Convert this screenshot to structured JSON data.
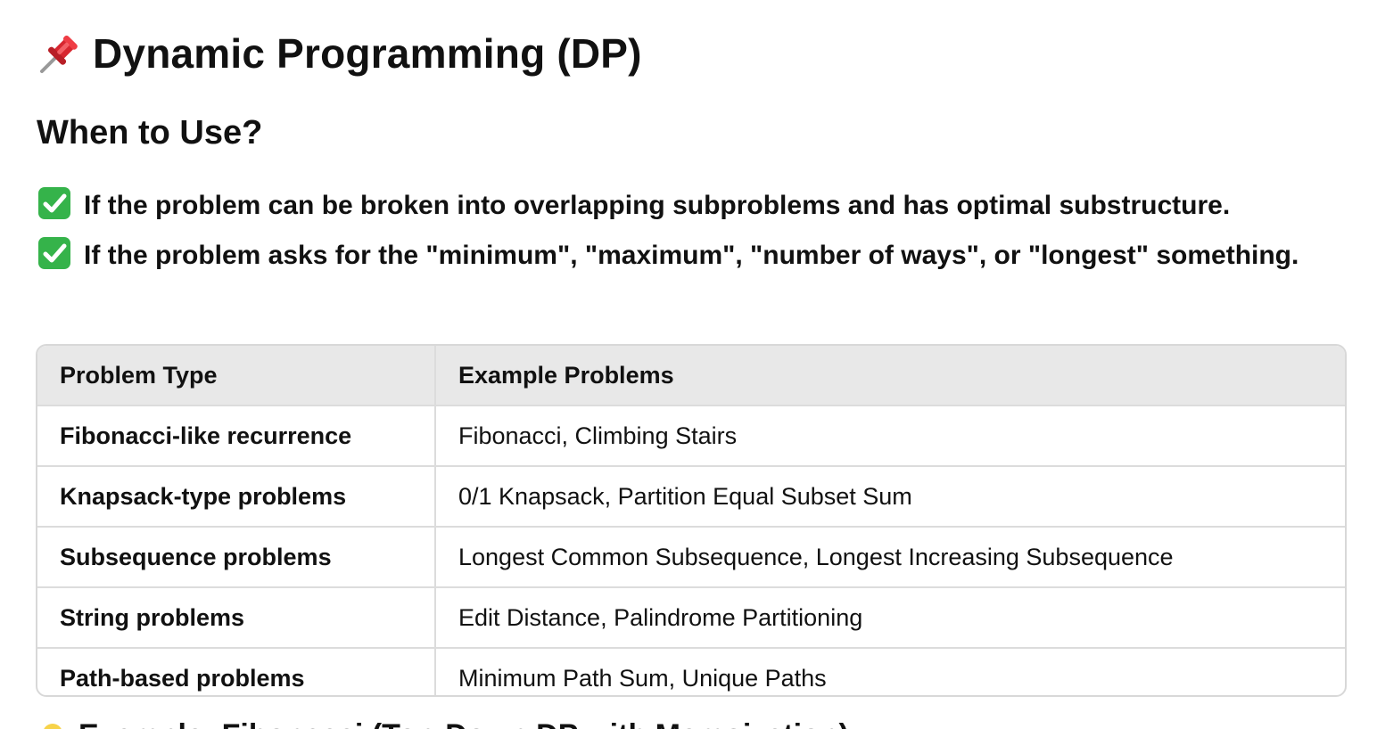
{
  "document": {
    "title": "Dynamic Programming (DP)",
    "title_icon": "pushpin-icon",
    "section_heading": "When to Use?",
    "criteria": [
      {
        "icon": "check-mark-icon",
        "text": "If the problem can be broken into overlapping subproblems and has optimal substructure."
      },
      {
        "icon": "check-mark-icon",
        "text": "If the problem asks for the \"minimum\", \"maximum\", \"number of ways\", or \"longest\" something."
      }
    ],
    "table": {
      "headers": [
        "Problem Type",
        "Example Problems"
      ],
      "rows": [
        [
          "Fibonacci-like recurrence",
          "Fibonacci, Climbing Stairs"
        ],
        [
          "Knapsack-type problems",
          "0/1 Knapsack, Partition Equal Subset Sum"
        ],
        [
          "Subsequence problems",
          "Longest Common Subsequence, Longest Increasing Subsequence"
        ],
        [
          "String problems",
          "Edit Distance, Palindrome Partitioning"
        ],
        [
          "Path-based problems",
          "Minimum Path Sum, Unique Paths"
        ]
      ]
    },
    "partial_next_heading": {
      "icon": "lightbulb-icon",
      "text": "Example: Fibonacci (Top-Down DP with Memoization)"
    }
  },
  "colors": {
    "text": "#111111",
    "table_header_bg": "#e8e8e8",
    "table_border": "#d8d8d8",
    "check_green": "#35b34a",
    "pin_red": "#d7262f"
  }
}
